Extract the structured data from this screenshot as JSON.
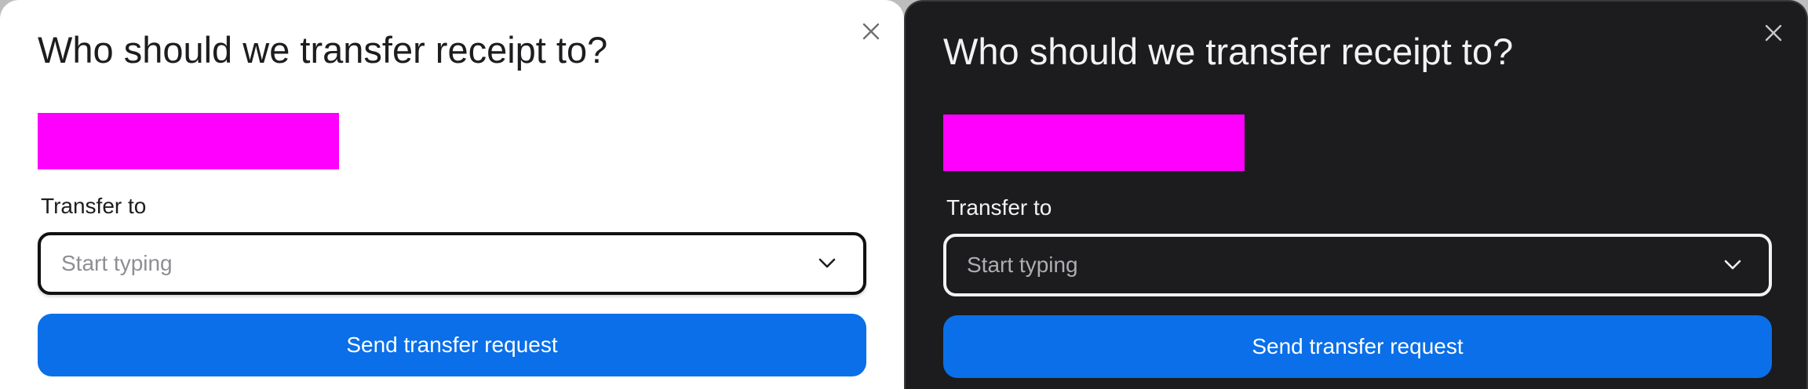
{
  "colors": {
    "accent": "#0a6fe8",
    "redaction": "#ff00ff",
    "light_background": "#ffffff",
    "dark_background": "#1c1c1e"
  },
  "dialogs": [
    {
      "theme": "light",
      "title": "Who should we transfer receipt to?",
      "close_icon": "close-icon",
      "field_label": "Transfer to",
      "field_placeholder": "Start typing",
      "field_value": "",
      "dropdown_icon": "chevron-down-icon",
      "primary_button": "Send transfer request"
    },
    {
      "theme": "dark",
      "title": "Who should we transfer receipt to?",
      "close_icon": "close-icon",
      "field_label": "Transfer to",
      "field_placeholder": "Start typing",
      "field_value": "",
      "dropdown_icon": "chevron-down-icon",
      "primary_button": "Send transfer request"
    }
  ]
}
